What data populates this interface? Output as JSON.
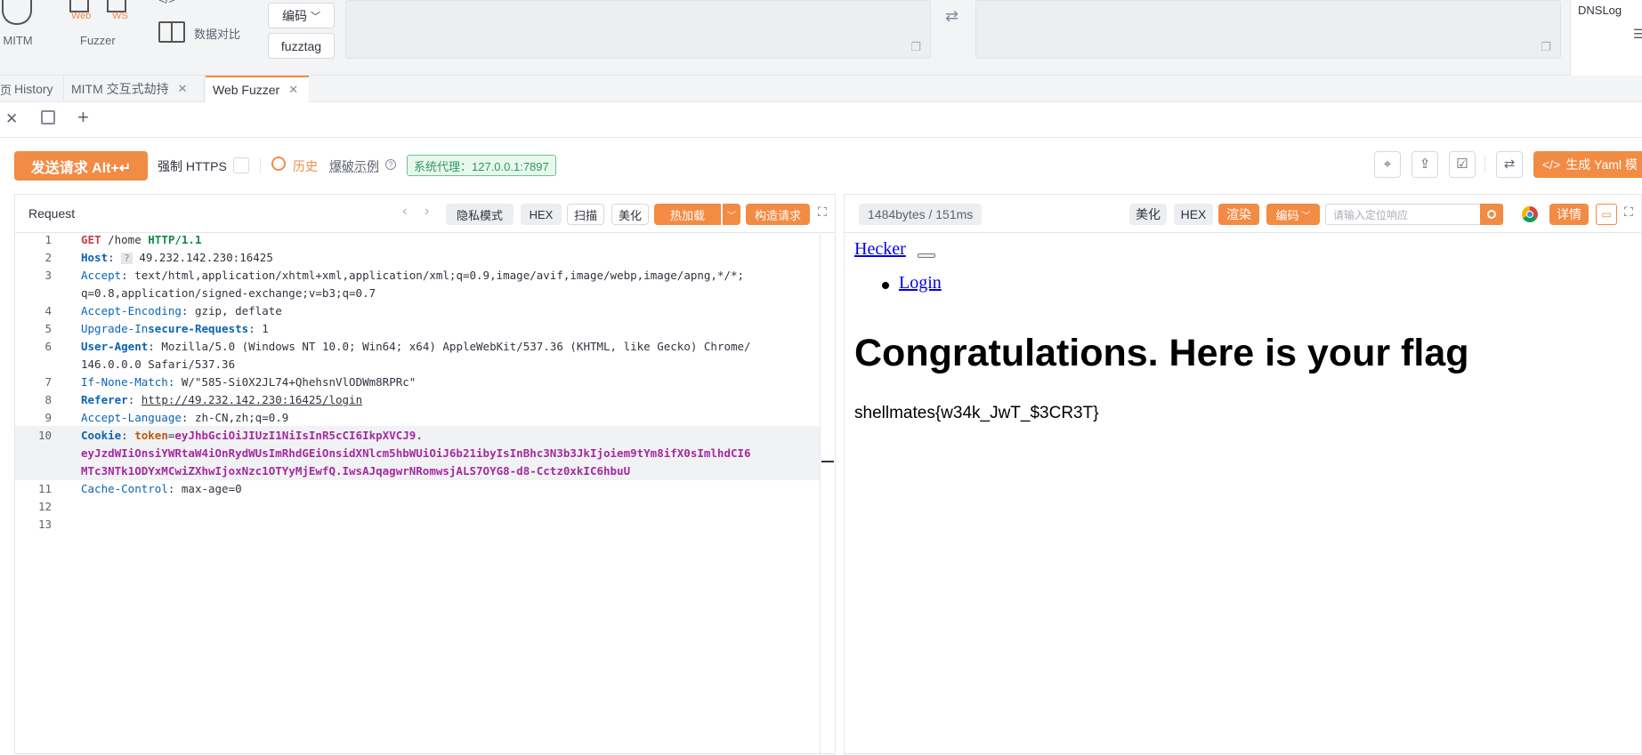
{
  "toolbar": {
    "mitm_label": "MITM",
    "fuzzer_label": "Fuzzer",
    "web_label": "Web",
    "ws_label": "WS",
    "data_compare_label": "数据对比",
    "encode_label": "编码",
    "fuzztag_label": "fuzztag",
    "dnslog_label": "DNSLog"
  },
  "tabs": [
    {
      "label": "History"
    },
    {
      "label": "MITM 交互式劫持"
    },
    {
      "label": "Web Fuzzer"
    }
  ],
  "actions": {
    "send_label": "发送请求 Alt+↵",
    "force_https_label": "强制 HTTPS",
    "history_label": "历史",
    "example_label": "爆破示例",
    "proxy_label": "系统代理：127.0.0.1:7897",
    "yaml_label": "生成 Yaml 模"
  },
  "request": {
    "title": "Request",
    "private_label": "隐私模式",
    "hex_label": "HEX",
    "scan_label": "扫描",
    "beautify_label": "美化",
    "hotload_label": "热加载",
    "build_label": "构造请求",
    "line_numbers": [
      "1",
      "2",
      "3",
      "4",
      "5",
      "6",
      "7",
      "8",
      "9",
      "10",
      "11",
      "12",
      "13"
    ],
    "method": "GET",
    "path": "/home",
    "protocol": "HTTP/1.1",
    "host_key": "Host",
    "host_val": "49.232.142.230:16425",
    "accept_key": "Accept",
    "accept_val1": "text/html,application/xhtml+xml,application/xml;q=0.9,image/avif,image/webp,image/apng,*/*;",
    "accept_val2": "q=0.8,application/signed-exchange;v=b3;q=0.7",
    "encoding_key": "Accept-Encoding",
    "encoding_val": "gzip, deflate",
    "upgrade_key_a": "Upgrade-In",
    "upgrade_key_b": "secure-Requests",
    "upgrade_val": "1",
    "ua_key": "User-Agent",
    "ua_val1": "Mozilla/5.0 (Windows NT 10.0; Win64; x64) AppleWebKit/537.36 (KHTML, like Gecko) Chrome/",
    "ua_val2": "146.0.0.0 Safari/537.36",
    "inm_key": "If-None-Match",
    "inm_val": "W/\"585-Si0X2JL74+QhehsnVlODWm8RPRc\"",
    "ref_key": "Referer",
    "ref_val": "http://49.232.142.230:16425/login",
    "lang_key": "Accept-Language",
    "lang_val": "zh-CN,zh;q=0.9",
    "cookie_key": "Cookie",
    "cookie_name": "token",
    "cookie_val1": "eyJhbGciOiJIUzI1NiIsInR5cCI6IkpXVCJ9.",
    "cookie_val2": "eyJzdWIiOnsiYWRtaW4iOnRydWUsImRhdGEiOnsidXNlcm5hbWUiOiJ6b21ibyIsInBhc3N3b3JkIjoiem9tYm8ifX0sImlhdCI6",
    "cookie_val3": "MTc3NTk1ODYxMCwiZXhwIjoxNzc1OTYyMjEwfQ.IwsAJqagwrNRomwsjALS7OYG8-d8-Cctz0xkIC6hbuU",
    "cache_key": "Cache-Control",
    "cache_val": "max-age=0"
  },
  "response": {
    "stats": "1484bytes / 151ms",
    "beautify_label": "美化",
    "hex_label": "HEX",
    "render_label": "渲染",
    "encode_label": "编码",
    "search_placeholder": "请输入定位响应",
    "detail_label": "详情",
    "brand_link": "Hecker",
    "nav_login": "Login",
    "heading": "Congratulations. Here is your flag",
    "flag": "shellmates{w34k_JwT_$3CR3T}"
  },
  "colors": {
    "accent": "#f28b44"
  }
}
